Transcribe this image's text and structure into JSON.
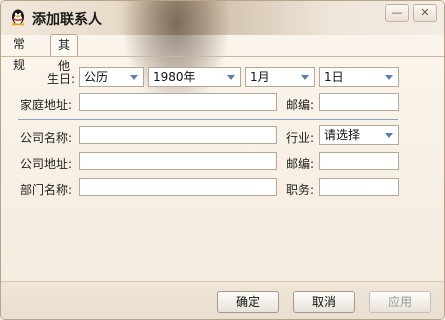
{
  "window": {
    "title": "添加联系人",
    "minimize": "—",
    "close": "✕"
  },
  "tabs": [
    {
      "label": "常规",
      "active": false
    },
    {
      "label": "其他",
      "active": true
    }
  ],
  "form": {
    "birthday_label": "生日:",
    "calendar_type": "公历",
    "year": "1980年",
    "month": "1月",
    "day": "1日",
    "home_address_label": "家庭地址:",
    "home_address_value": "",
    "home_zip_label": "邮编:",
    "home_zip_value": "",
    "company_name_label": "公司名称:",
    "company_name_value": "",
    "industry_label": "行业:",
    "industry_value": "请选择",
    "company_address_label": "公司地址:",
    "company_address_value": "",
    "company_zip_label": "邮编:",
    "company_zip_value": "",
    "department_label": "部门名称:",
    "department_value": "",
    "position_label": "职务:",
    "position_value": ""
  },
  "buttons": {
    "ok": "确定",
    "cancel": "取消",
    "apply": "应用"
  },
  "colors": {
    "accent_arrow": "#5a7fb0",
    "divider": "#8ea2c1"
  }
}
